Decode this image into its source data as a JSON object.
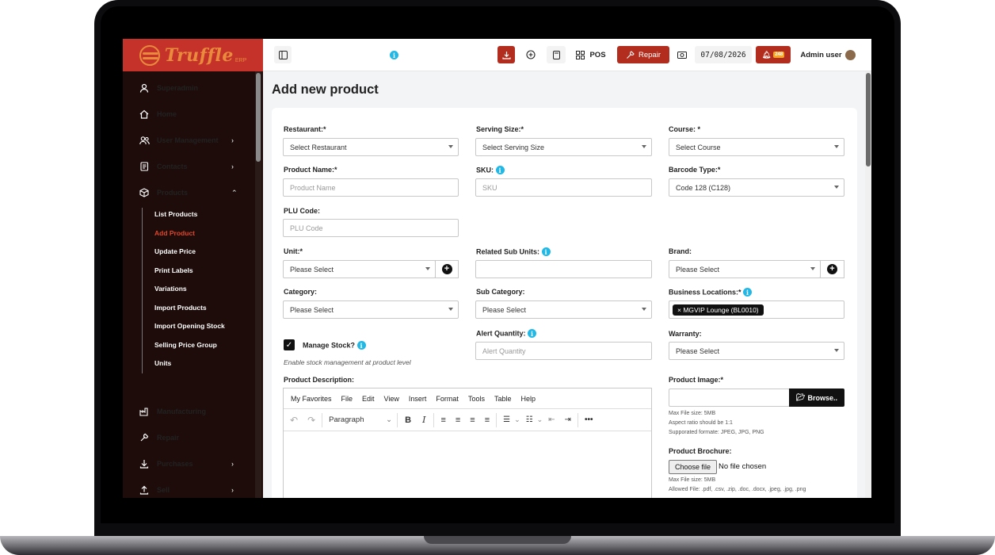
{
  "app": {
    "logo_text": "Truffle",
    "logo_sub": "ERP"
  },
  "sidebar": {
    "items": [
      {
        "label": "Superadmin",
        "icon": "user-icon",
        "chevron": false
      },
      {
        "label": "Home",
        "icon": "home-icon",
        "chevron": false
      },
      {
        "label": "User Management",
        "icon": "users-icon",
        "chevron": true
      },
      {
        "label": "Contacts",
        "icon": "address-book-icon",
        "chevron": true
      },
      {
        "label": "Products",
        "icon": "cube-icon",
        "chevron": true
      }
    ],
    "sub_items": [
      "List Products",
      "Add Product",
      "Update Price",
      "Print Labels",
      "Variations",
      "Import Products",
      "Import Opening Stock",
      "Selling Price Group",
      "Units"
    ],
    "bottom_items": [
      {
        "label": "Manufacturing",
        "icon": "factory-icon",
        "chevron": false
      },
      {
        "label": "Repair",
        "icon": "wrench-icon",
        "chevron": false
      },
      {
        "label": "Purchases",
        "icon": "download-icon",
        "chevron": true
      },
      {
        "label": "Sell",
        "icon": "upload-icon",
        "chevron": true
      }
    ]
  },
  "topbar": {
    "pos": "POS",
    "repair": "Repair",
    "date": "07/08/2026",
    "notif_count": "248",
    "user": "Admin user"
  },
  "page": {
    "title": "Add new product"
  },
  "form": {
    "restaurant": {
      "label": "Restaurant:*",
      "value": "Select Restaurant"
    },
    "serving_size": {
      "label": "Serving Size:*",
      "value": "Select Serving Size"
    },
    "course": {
      "label": "Course: *",
      "value": "Select Course"
    },
    "product_name": {
      "label": "Product Name:*",
      "placeholder": "Product Name"
    },
    "sku": {
      "label": "SKU:",
      "placeholder": "SKU"
    },
    "barcode_type": {
      "label": "Barcode Type:*",
      "value": "Code 128 (C128)"
    },
    "plu_code": {
      "label": "PLU Code:",
      "placeholder": "PLU Code"
    },
    "unit": {
      "label": "Unit:*",
      "value": "Please Select"
    },
    "related_sub_units": {
      "label": "Related Sub Units:"
    },
    "brand": {
      "label": "Brand:",
      "value": "Please Select"
    },
    "category": {
      "label": "Category:",
      "value": "Please Select"
    },
    "sub_category": {
      "label": "Sub Category:",
      "value": "Please Select"
    },
    "business_locations": {
      "label": "Business Locations:*",
      "tag": "MGVIP Lounge (BL0010)",
      "tag_x": "×"
    },
    "manage_stock": {
      "label": "Manage Stock?",
      "hint": "Enable stock management at product level"
    },
    "alert_quantity": {
      "label": "Alert Quantity:",
      "placeholder": "Alert Quantity"
    },
    "warranty": {
      "label": "Warranty:",
      "value": "Please Select"
    },
    "product_description": {
      "label": "Product Description:"
    },
    "product_image": {
      "label": "Product Image:*",
      "browse": "Browse..",
      "hint1": "Max File size: 5MB",
      "hint2": "Aspect ratio should be 1:1",
      "hint3": "Supporated formate: JPEG, JPG, PNG"
    },
    "product_brochure": {
      "label": "Product Brochure:",
      "choose": "Choose file",
      "no_file": "No file chosen",
      "hint1": "Max File size: 5MB",
      "hint2": "Allowed File: .pdf, .csv, .zip, .doc, .docx, .jpeg, .jpg, .png"
    }
  },
  "editor": {
    "menus": [
      "My Favorites",
      "File",
      "Edit",
      "View",
      "Insert",
      "Format",
      "Tools",
      "Table",
      "Help"
    ],
    "block_format": "Paragraph"
  }
}
